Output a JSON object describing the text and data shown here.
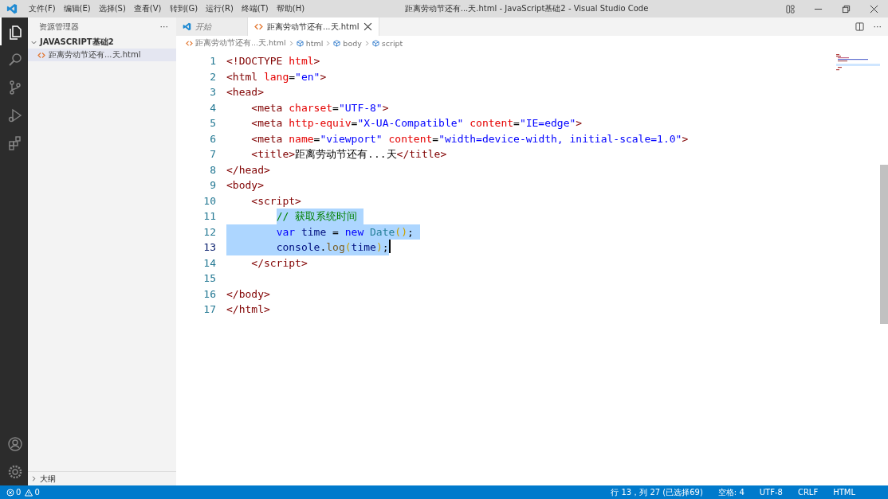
{
  "window": {
    "title": "距离劳动节还有...天.html - JavaScript基础2 - Visual Studio Code"
  },
  "menu": [
    "文件(F)",
    "编辑(E)",
    "选择(S)",
    "查看(V)",
    "转到(G)",
    "运行(R)",
    "终端(T)",
    "帮助(H)"
  ],
  "activity_bar": [
    {
      "kind": "files",
      "selected": true
    },
    {
      "kind": "search",
      "selected": false
    },
    {
      "kind": "scm",
      "selected": false
    },
    {
      "kind": "debug",
      "selected": false
    },
    {
      "kind": "extensions",
      "selected": false
    }
  ],
  "sidebar": {
    "title": "资源管理器",
    "more": "···",
    "sections": [
      {
        "label": "JAVASCRIPT基础2",
        "expanded": true,
        "items": [
          {
            "label": "距离劳动节还有...天.html",
            "selected": true
          }
        ]
      },
      {
        "label": "大纲",
        "expanded": false
      }
    ]
  },
  "tabs": [
    {
      "kind": "welcome",
      "label": "开始",
      "selected": false
    },
    {
      "kind": "html",
      "label": "距离劳动节还有...天.html",
      "selected": true
    }
  ],
  "tab_actions": {
    "more": "···"
  },
  "breadcrumb": [
    {
      "kind": "file",
      "label": "距离劳动节还有...天.html"
    },
    {
      "kind": "symbol",
      "label": "html"
    },
    {
      "kind": "symbol",
      "label": "body"
    },
    {
      "kind": "symbol",
      "label": "script"
    }
  ],
  "lines": [
    {
      "number": "1",
      "active": false,
      "cursor": false,
      "selected": false,
      "tokens": [
        {
          "kind": "tag",
          "text": "<!DOCTYPE"
        },
        {
          "kind": "attr",
          "text": " html"
        },
        {
          "kind": "tag",
          "text": ">"
        }
      ]
    },
    {
      "number": "2",
      "active": false,
      "cursor": false,
      "selected": false,
      "tokens": [
        {
          "kind": "tag",
          "text": "<html"
        },
        {
          "kind": "attr",
          "text": " lang"
        },
        {
          "kind": "punct",
          "text": "="
        },
        {
          "kind": "str",
          "text": "\"en\""
        },
        {
          "kind": "tag",
          "text": ">"
        }
      ]
    },
    {
      "number": "3",
      "active": false,
      "cursor": false,
      "selected": false,
      "tokens": [
        {
          "kind": "tag",
          "text": "<head>"
        }
      ]
    },
    {
      "number": "4",
      "active": false,
      "cursor": false,
      "selected": false,
      "indent_selected": false,
      "tokens": [
        {
          "kind": "tag",
          "text": "    <meta"
        },
        {
          "kind": "attr",
          "text": " charset"
        },
        {
          "kind": "punct",
          "text": "="
        },
        {
          "kind": "str",
          "text": "\"UTF-8\""
        },
        {
          "kind": "tag",
          "text": ">"
        }
      ]
    },
    {
      "number": "5",
      "active": false,
      "cursor": false,
      "selected": false,
      "indent_selected": false,
      "tokens": [
        {
          "kind": "tag",
          "text": "    <meta"
        },
        {
          "kind": "attr",
          "text": " http-equiv"
        },
        {
          "kind": "punct",
          "text": "="
        },
        {
          "kind": "str",
          "text": "\"X-UA-Compatible\""
        },
        {
          "kind": "attr",
          "text": " content"
        },
        {
          "kind": "punct",
          "text": "="
        },
        {
          "kind": "str",
          "text": "\"IE=edge\""
        },
        {
          "kind": "tag",
          "text": ">"
        }
      ]
    },
    {
      "number": "6",
      "active": false,
      "cursor": false,
      "selected": false,
      "indent_selected": false,
      "tokens": [
        {
          "kind": "tag",
          "text": "    <meta"
        },
        {
          "kind": "attr",
          "text": " name"
        },
        {
          "kind": "punct",
          "text": "="
        },
        {
          "kind": "str",
          "text": "\"viewport\""
        },
        {
          "kind": "attr",
          "text": " content"
        },
        {
          "kind": "punct",
          "text": "="
        },
        {
          "kind": "str",
          "text": "\"width=device-width, initial-scale=1.0\""
        },
        {
          "kind": "tag",
          "text": ">"
        }
      ]
    },
    {
      "number": "7",
      "active": false,
      "cursor": false,
      "selected": false,
      "indent_selected": false,
      "tokens": [
        {
          "kind": "tag",
          "text": "    <title>"
        },
        {
          "kind": "text",
          "text": "距离劳动节还有...天"
        },
        {
          "kind": "tag",
          "text": "</title>"
        }
      ]
    },
    {
      "number": "8",
      "active": false,
      "cursor": false,
      "selected": false,
      "tokens": [
        {
          "kind": "tag",
          "text": "</head>"
        }
      ]
    },
    {
      "number": "9",
      "active": false,
      "cursor": false,
      "selected": false,
      "tokens": [
        {
          "kind": "tag",
          "text": "<body>"
        }
      ]
    },
    {
      "number": "10",
      "active": false,
      "cursor": false,
      "selected": false,
      "indent_selected": false,
      "tokens": [
        {
          "kind": "tag",
          "text": "    <script>"
        }
      ]
    },
    {
      "number": "11",
      "active": false,
      "cursor": false,
      "selected": true,
      "indent_selected": false,
      "tokens": [
        {
          "kind": "comment",
          "text": "        // 获取系统时间"
        }
      ]
    },
    {
      "number": "12",
      "active": false,
      "cursor": false,
      "selected": true,
      "indent_selected": true,
      "tokens": [
        {
          "kind": "keyword",
          "text": "        var"
        },
        {
          "kind": "ident",
          "text": " time"
        },
        {
          "kind": "punct",
          "text": " ="
        },
        {
          "kind": "keyword",
          "text": " new"
        },
        {
          "kind": "type",
          "text": " Date"
        },
        {
          "kind": "bracket",
          "text": "()"
        },
        {
          "kind": "punct",
          "text": ";"
        }
      ]
    },
    {
      "number": "13",
      "active": true,
      "cursor": true,
      "selected": true,
      "indent_selected": true,
      "tokens": [
        {
          "kind": "ident",
          "text": "        console"
        },
        {
          "kind": "punct",
          "text": "."
        },
        {
          "kind": "func",
          "text": "log"
        },
        {
          "kind": "bracket",
          "text": "("
        },
        {
          "kind": "ident",
          "text": "time"
        },
        {
          "kind": "bracket",
          "text": ")"
        },
        {
          "kind": "punct",
          "text": ";"
        }
      ]
    },
    {
      "number": "14",
      "active": false,
      "cursor": false,
      "selected": false,
      "indent_selected": false,
      "tokens": [
        {
          "kind": "tag",
          "text": "    </script>"
        }
      ]
    },
    {
      "number": "15",
      "active": false,
      "cursor": false,
      "selected": false
    },
    {
      "number": "16",
      "active": false,
      "cursor": false,
      "selected": false,
      "tokens": [
        {
          "kind": "tag",
          "text": "</body>"
        }
      ]
    },
    {
      "number": "17",
      "active": false,
      "cursor": false,
      "selected": false,
      "tokens": [
        {
          "kind": "tag",
          "text": "</html>"
        }
      ]
    }
  ],
  "status_bar": {
    "errors": "0",
    "warnings": "0",
    "position": "行 13，列 27 (已选择69)",
    "indent": "空格: 4",
    "encoding": "UTF-8",
    "eol": "CRLF",
    "language": "HTML"
  }
}
